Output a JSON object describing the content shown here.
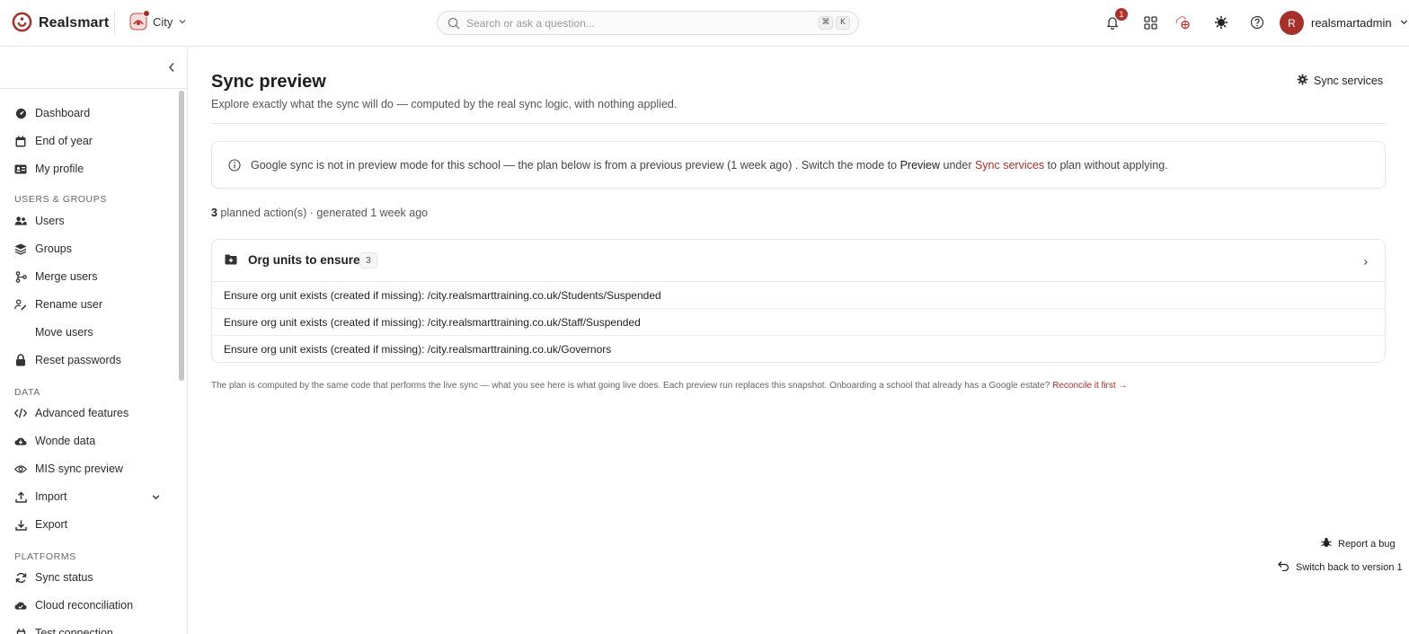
{
  "brand": {
    "name": "Realsmart"
  },
  "school": {
    "name": "City"
  },
  "search": {
    "placeholder": "Search or ask a question...",
    "shortcut_mod": "⌘",
    "shortcut_key": "K"
  },
  "header": {
    "notification_count": "1",
    "username": "realsmartadmin",
    "avatar_initial": "R"
  },
  "sidebar": {
    "items_top": [
      {
        "label": "Dashboard",
        "icon": "dashboard-icon"
      },
      {
        "label": "End of year",
        "icon": "calendar-icon"
      },
      {
        "label": "My profile",
        "icon": "id-card-icon"
      }
    ],
    "sections": [
      {
        "title": "USERS & GROUPS",
        "items": [
          "Users",
          "Groups",
          "Merge users",
          "Rename user",
          "Move users",
          "Reset passwords"
        ]
      },
      {
        "title": "DATA",
        "items": [
          "Advanced features",
          "Wonde data",
          "MIS sync preview",
          "Import",
          "Export"
        ]
      },
      {
        "title": "PLATFORMS",
        "items": [
          "Sync status",
          "Cloud reconciliation",
          "Test connection"
        ]
      }
    ]
  },
  "page": {
    "title": "Sync preview",
    "subtitle": "Explore exactly what the sync will do — computed by the real sync logic, with nothing applied.",
    "sync_services_label": "Sync services"
  },
  "notice": {
    "part1": "Google sync is not in preview mode for this school — the plan below is from a previous preview (1 week ago) . Switch the mode to ",
    "bold": "Preview",
    "part2": " under ",
    "link": "Sync services",
    "part3": " to plan without applying."
  },
  "summary": {
    "count": "3",
    "text": " planned action(s) · generated 1 week ago"
  },
  "card": {
    "title": "Org units to ensure",
    "count": "3",
    "rows": [
      "Ensure org unit exists (created if missing): /city.realsmarttraining.co.uk/Students/Suspended",
      "Ensure org unit exists (created if missing): /city.realsmarttraining.co.uk/Staff/Suspended",
      "Ensure org unit exists (created if missing): /city.realsmarttraining.co.uk/Governors"
    ]
  },
  "footnote": {
    "text": "The plan is computed by the same code that performs the live sync — what you see here is what going live does. Each preview run replaces this snapshot. Onboarding a school that already has a Google estate? ",
    "link": "Reconcile it first →"
  },
  "floating": {
    "report_bug": "Report a bug",
    "switch_back": "Switch back to version 1"
  },
  "colors": {
    "accent": "#a8302b",
    "border": "#e6e6e6"
  }
}
